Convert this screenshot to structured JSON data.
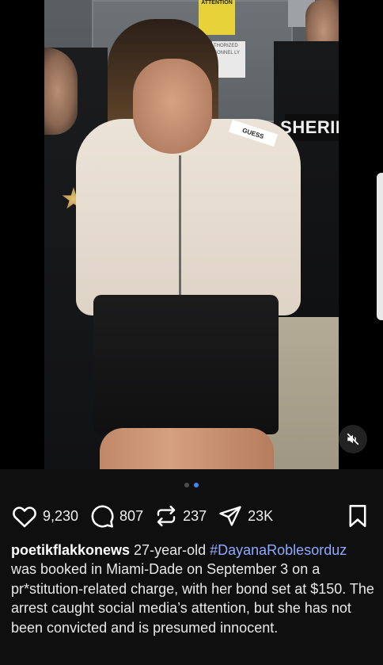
{
  "post": {
    "media": {
      "sign_attention": "ATTENTION",
      "sign_authorized": "THORIZED SONNEL LY",
      "officer_label": "SHERIF",
      "jacket_print": "GUESS",
      "carousel": {
        "count": 2,
        "active_index": 1
      }
    },
    "actions": {
      "likes": "9,230",
      "comments": "807",
      "reposts": "237",
      "shares": "23K"
    },
    "caption": {
      "username": "poetikflakkonews",
      "text_before_tag": " 27-year-old ",
      "hashtag": "#DayanaRoblesorduz",
      "text_after_tag": " was booked in Miami-Dade on September 3 on a pr*stitution-related charge, with her bond set at $150. The arrest caught social media’s attention, but she has not been convicted and is presumed innocent."
    }
  },
  "icons": {
    "like": "heart-icon",
    "comment": "comment-bubble-icon",
    "repost": "repost-icon",
    "share": "send-icon",
    "save": "bookmark-icon",
    "mute": "mute-icon"
  },
  "colors": {
    "background": "#0f0f10",
    "hashtag": "#8ea9ff",
    "active_dot": "#3f86ff"
  }
}
